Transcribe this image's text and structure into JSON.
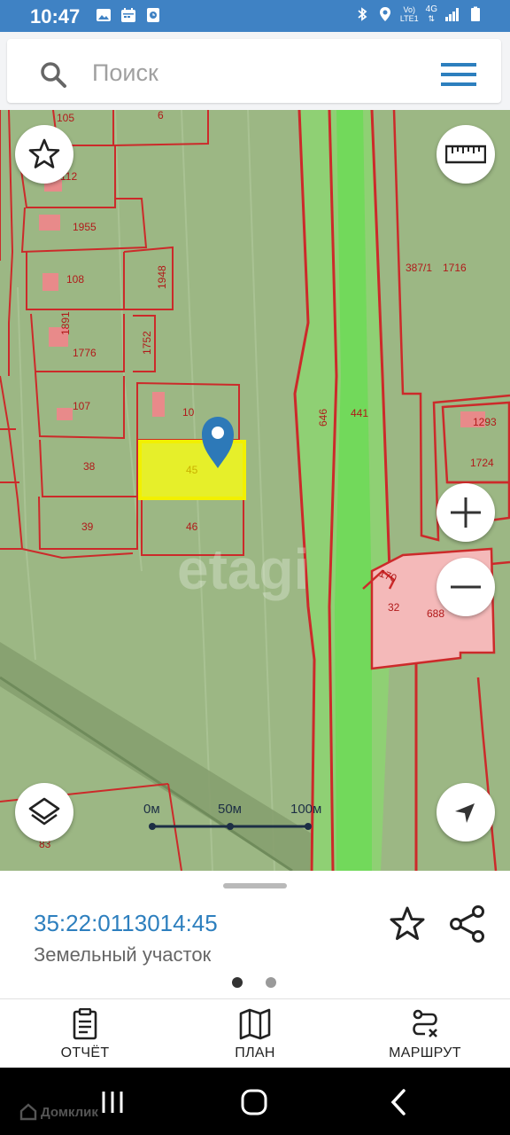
{
  "status_bar": {
    "time": "10:47",
    "left_icons": [
      "gallery-icon",
      "calendar-icon",
      "app-icon"
    ],
    "right_icons": [
      "bluetooth-icon",
      "location-icon",
      "volte-icon",
      "4g-icon",
      "signal-icon",
      "battery-icon"
    ],
    "volte_line1": "Vo)",
    "volte_line2": "LTE1",
    "net_label": "4G"
  },
  "search": {
    "placeholder": "Поиск"
  },
  "map": {
    "watermark": "etagi",
    "parcel_labels": [
      "105",
      "6",
      "112",
      "1955",
      "108",
      "1948",
      "1891",
      "1776",
      "1752",
      "107",
      "10",
      "38",
      "45",
      "39",
      "46",
      "646",
      "441",
      "387/1",
      "1716",
      "1293",
      "1724",
      "170",
      "32",
      "688",
      "83"
    ],
    "scale_labels": [
      "0м",
      "50м",
      "100м"
    ],
    "selected_parcel": "45",
    "colors": {
      "map_bg": "#9cb784",
      "boundary": "#cc2a2a",
      "highlight": "#e9f200",
      "road": "#7ed86a",
      "marker": "#2d79b8"
    }
  },
  "parcel": {
    "cadastral_number": "35:22:0113014:45",
    "type": "Земельный участок",
    "active_page": 1,
    "page_count": 2
  },
  "bottom_nav": {
    "items": [
      {
        "label": "ОТЧЁТ",
        "icon": "clipboard-report-icon"
      },
      {
        "label": "ПЛАН",
        "icon": "map-plan-icon"
      },
      {
        "label": "МАРШРУТ",
        "icon": "route-icon"
      }
    ]
  },
  "system_nav": {
    "watermark_logo": "Домклик"
  }
}
